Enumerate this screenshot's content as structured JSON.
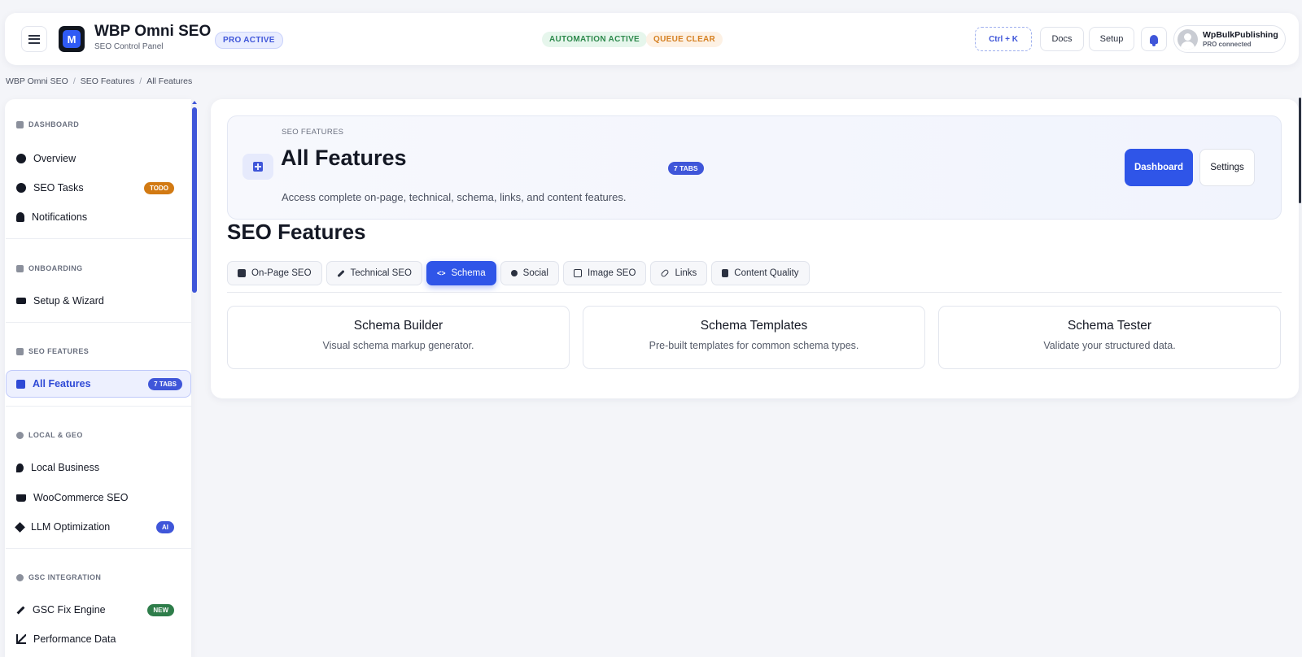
{
  "header": {
    "app_title": "WBP Omni SEO",
    "app_subtitle": "SEO Control Panel",
    "logo_letter": "M",
    "pro_badge": "PRO ACTIVE",
    "automation_status": "AUTOMATION ACTIVE",
    "queue_status": "QUEUE CLEAR",
    "shortcut_label": "Ctrl + K",
    "docs_label": "Docs",
    "setup_label": "Setup",
    "user_name": "WpBulkPublishing",
    "user_status": "PRO connected"
  },
  "breadcrumb": [
    "WBP Omni SEO",
    "SEO Features",
    "All Features"
  ],
  "sidebar": {
    "sections": [
      {
        "title": "DASHBOARD",
        "items": [
          {
            "label": "Overview",
            "icon": "dashboard-icon"
          },
          {
            "label": "SEO Tasks",
            "icon": "check-circle-icon",
            "badge": "TODO"
          },
          {
            "label": "Notifications",
            "icon": "bell-icon"
          }
        ]
      },
      {
        "title": "ONBOARDING",
        "items": [
          {
            "label": "Setup & Wizard",
            "icon": "graduation-cap-icon"
          }
        ]
      },
      {
        "title": "SEO FEATURES",
        "items": [
          {
            "label": "All Features",
            "icon": "grid-plus-icon",
            "badge": "7 TABS",
            "active": true
          }
        ]
      },
      {
        "title": "LOCAL & GEO",
        "items": [
          {
            "label": "Local Business",
            "icon": "location-pin-icon"
          },
          {
            "label": "WooCommerce SEO",
            "icon": "cart-icon"
          },
          {
            "label": "LLM Optimization",
            "icon": "diamond-icon",
            "badge": "AI"
          }
        ]
      },
      {
        "title": "GSC INTEGRATION",
        "items": [
          {
            "label": "GSC Fix Engine",
            "icon": "hammer-icon",
            "badge": "NEW"
          },
          {
            "label": "Performance Data",
            "icon": "chart-icon"
          }
        ]
      }
    ]
  },
  "hero": {
    "eyebrow": "SEO FEATURES",
    "title": "All Features",
    "badge": "7 TABS",
    "description": "Access complete on-page, technical, schema, links, and content features.",
    "primary_button": "Dashboard",
    "secondary_button": "Settings"
  },
  "section_title": "SEO Features",
  "tabs": [
    {
      "label": "On-Page SEO",
      "icon": "edit-icon"
    },
    {
      "label": "Technical SEO",
      "icon": "wrench-icon"
    },
    {
      "label": "Schema",
      "icon": "code-icon",
      "active": true
    },
    {
      "label": "Social",
      "icon": "share-icon"
    },
    {
      "label": "Image SEO",
      "icon": "image-icon"
    },
    {
      "label": "Links",
      "icon": "link-icon"
    },
    {
      "label": "Content Quality",
      "icon": "document-icon"
    }
  ],
  "cards": [
    {
      "title": "Schema Builder",
      "description": "Visual schema markup generator."
    },
    {
      "title": "Schema Templates",
      "description": "Pre-built templates for common schema types."
    },
    {
      "title": "Schema Tester",
      "description": "Validate your structured data."
    }
  ],
  "colors": {
    "accent": "#2f55e8",
    "todo_badge": "#d27a13",
    "new_badge": "#2e7d4a",
    "automation_green": "#2e8a4d",
    "queue_orange": "#d58022"
  }
}
